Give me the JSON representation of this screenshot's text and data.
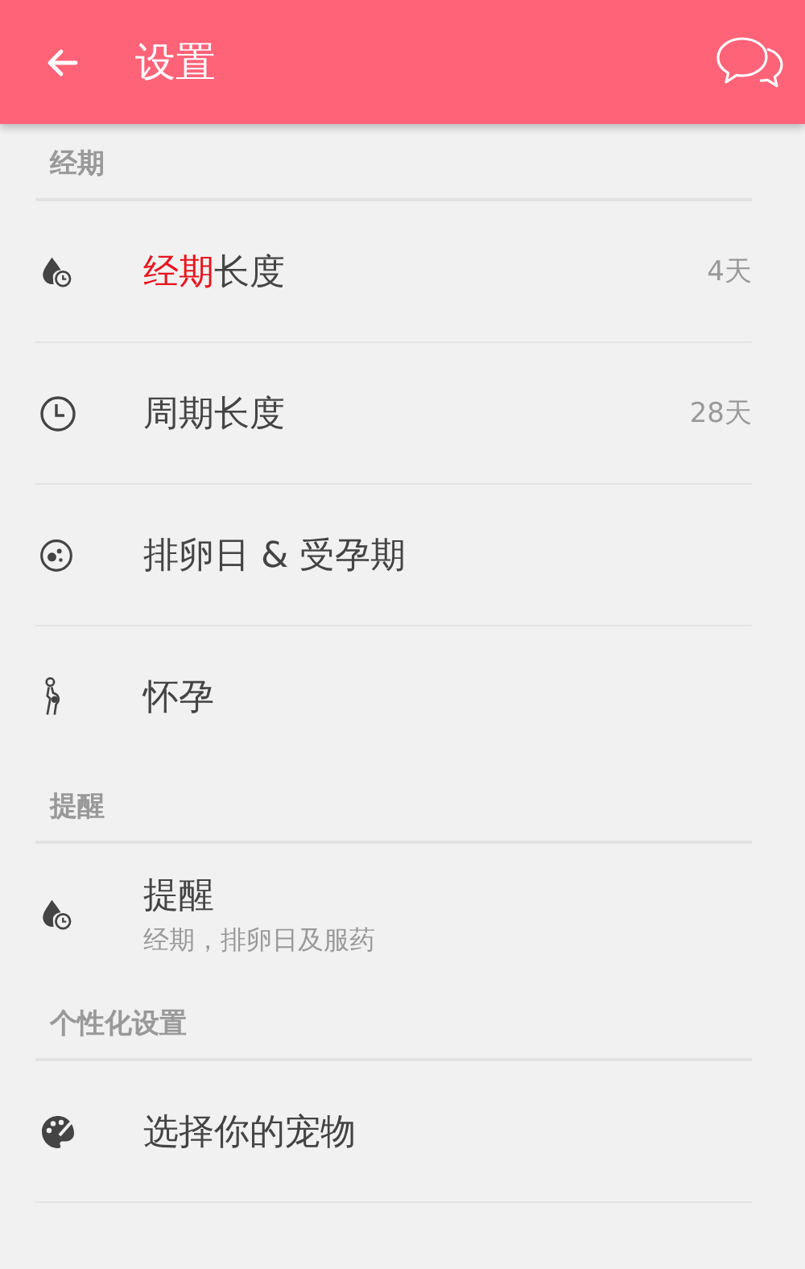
{
  "header": {
    "title": "设置"
  },
  "sections": [
    {
      "title": "经期",
      "items": [
        {
          "kind": "value",
          "highlight": "经期",
          "label": "长度",
          "value": "4天"
        },
        {
          "kind": "value",
          "label": "周期长度",
          "value": "28天"
        },
        {
          "kind": "plain",
          "label": "排卵日 & 受孕期"
        },
        {
          "kind": "plain",
          "label": "怀孕"
        }
      ]
    },
    {
      "title": "提醒",
      "items": [
        {
          "kind": "subtitle",
          "label": "提醒",
          "subtitle": "经期，排卵日及服药"
        }
      ]
    },
    {
      "title": "个性化设置",
      "items": [
        {
          "kind": "plain",
          "label": "选择你的宠物"
        }
      ]
    }
  ]
}
